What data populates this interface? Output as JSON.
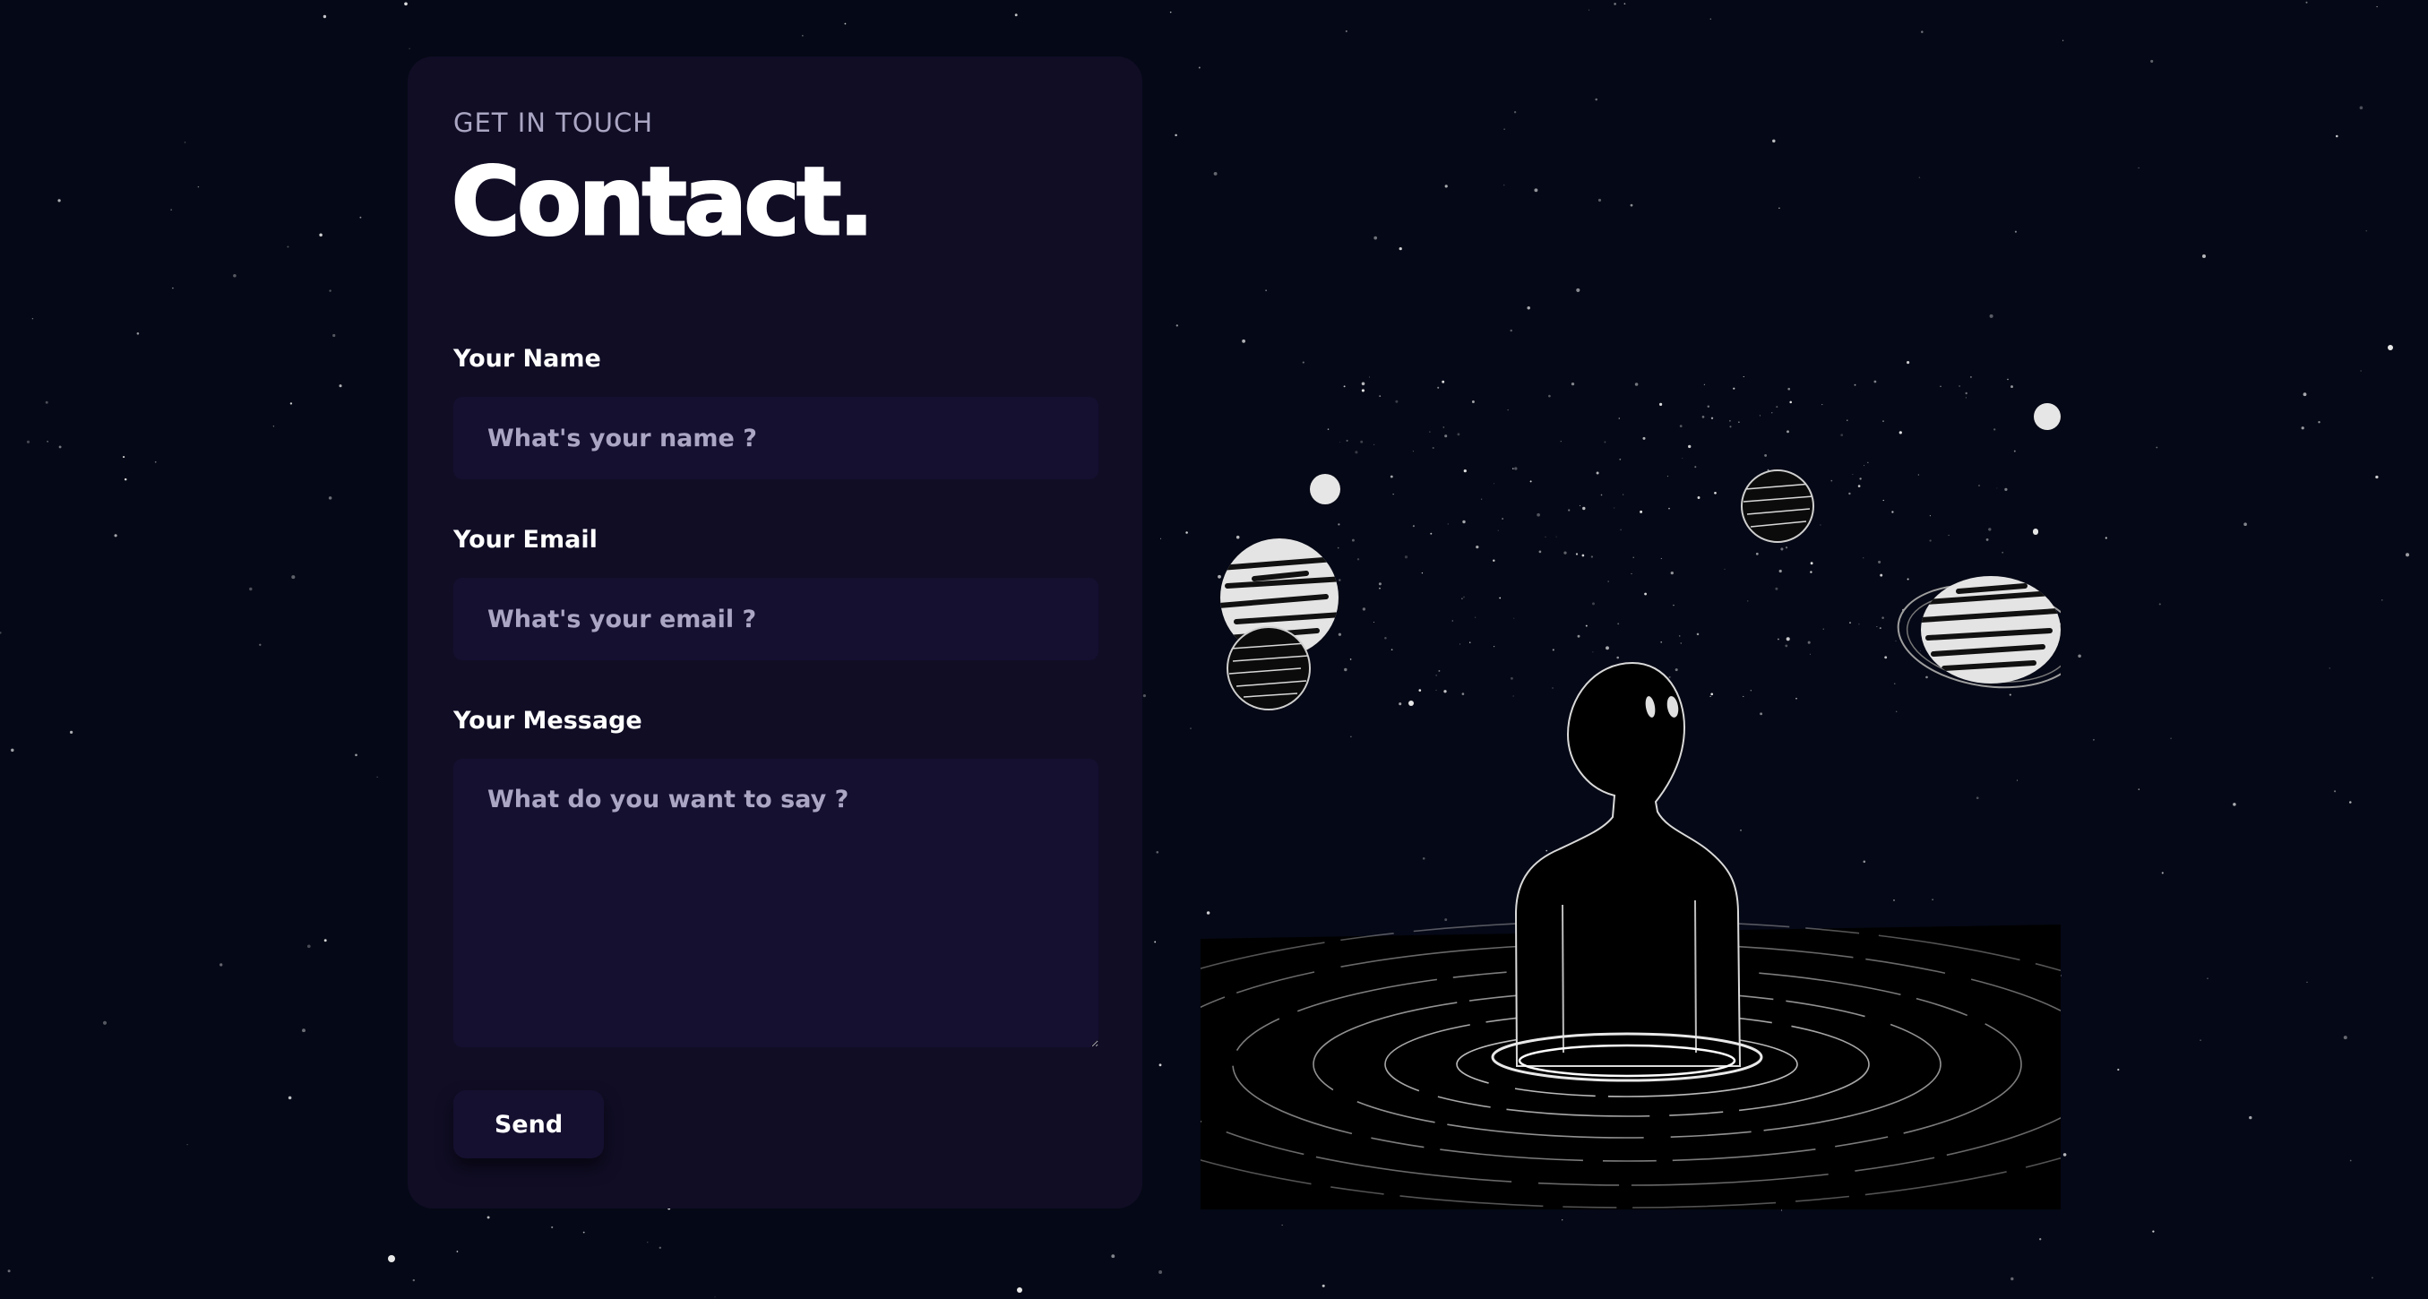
{
  "contact": {
    "eyebrow": "GET IN TOUCH",
    "title": "Contact.",
    "name_label": "Your Name",
    "name_placeholder": "What's your name ?",
    "email_label": "Your Email",
    "email_placeholder": "What's your email ?",
    "message_label": "Your Message",
    "message_placeholder": "What do you want to say ?",
    "send_label": "Send"
  },
  "colors": {
    "background": "#050816",
    "card": "#100d25",
    "field": "#151030",
    "muted_text": "#aaa6c3",
    "text": "#ffffff"
  },
  "illustration": {
    "subject": "silhouette-figure-in-water-with-planets-icon"
  }
}
